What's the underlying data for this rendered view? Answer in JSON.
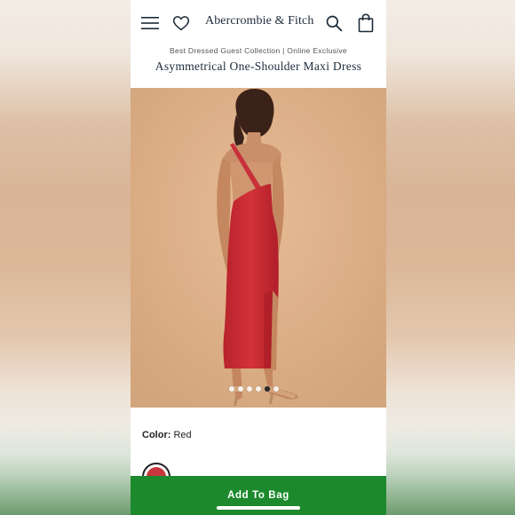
{
  "header": {
    "brand": "Abercrombie & Fitch",
    "icons": [
      "menu-icon",
      "heart-icon",
      "search-icon",
      "bag-icon"
    ]
  },
  "product": {
    "collection": "Best Dressed Guest Collection | Online Exclusive",
    "title": "Asymmetrical One-Shoulder Maxi Dress",
    "image_count": 6,
    "active_image_index": 4,
    "color_label": "Color:",
    "color_value": "Red",
    "swatch_color": "#c8373b"
  },
  "cta": {
    "add_to_bag": "Add To Bag",
    "color": "#1c8a2c"
  }
}
